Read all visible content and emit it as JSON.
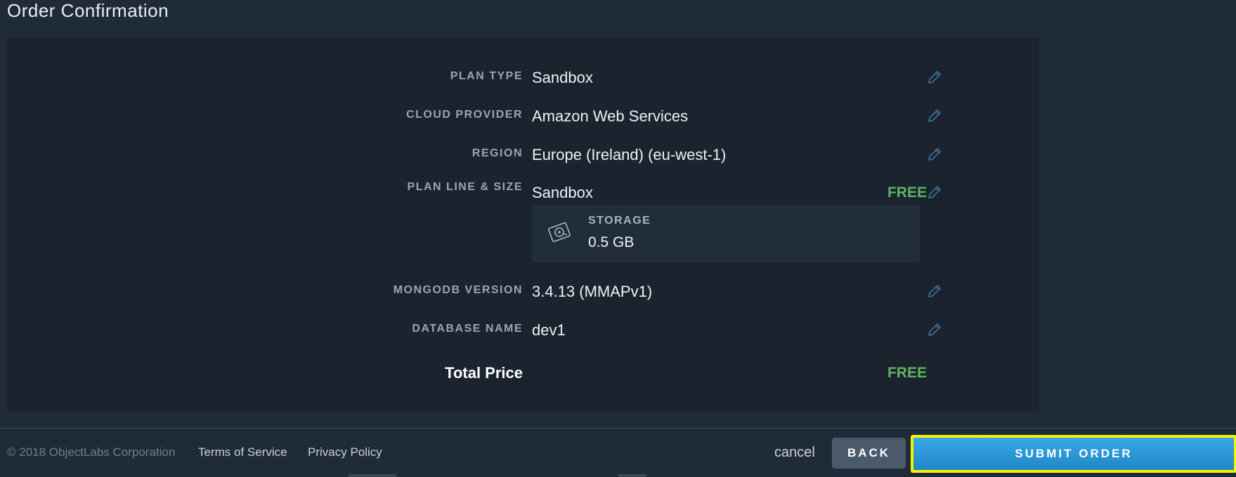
{
  "page": {
    "title": "Order Confirmation"
  },
  "order": {
    "rows": [
      {
        "label": "PLAN TYPE",
        "value": "Sandbox",
        "editable": true
      },
      {
        "label": "CLOUD PROVIDER",
        "value": "Amazon Web Services",
        "editable": true
      },
      {
        "label": "REGION",
        "value": "Europe (Ireland) (eu-west-1)",
        "editable": true
      },
      {
        "label": "PLAN LINE & SIZE",
        "value": "Sandbox",
        "price": "FREE",
        "editable": true
      },
      {
        "label": "MONGODB VERSION",
        "value": "3.4.13 (MMAPv1)",
        "editable": true
      },
      {
        "label": "DATABASE NAME",
        "value": "dev1",
        "editable": true
      }
    ],
    "storage": {
      "label": "STORAGE",
      "value": "0.5 GB"
    },
    "total": {
      "label": "Total Price",
      "value": "FREE"
    }
  },
  "footer": {
    "copyright": "© 2018 ObjectLabs Corporation",
    "terms_label": "Terms of Service",
    "privacy_label": "Privacy Policy",
    "cancel_label": "cancel",
    "back_label": "BACK",
    "submit_label": "SUBMIT ORDER"
  },
  "colors": {
    "background": "#1f2b38",
    "panel": "#1a232e",
    "free_green": "#5fb35f",
    "submit_blue": "#2b96d8",
    "highlight_yellow": "#f3f300",
    "edit_icon": "#3d6f93"
  },
  "icons": {
    "edit": "pencil-icon",
    "storage": "disk-icon"
  }
}
